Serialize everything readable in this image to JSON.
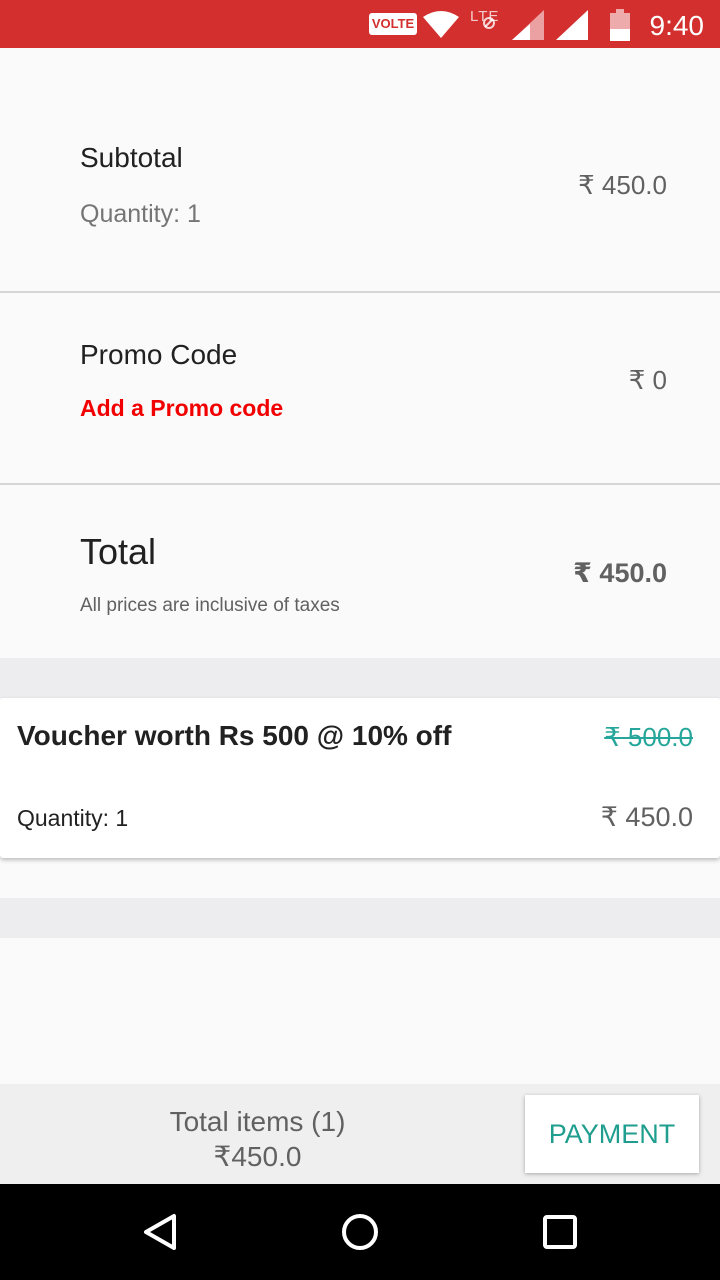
{
  "status_bar": {
    "volte": "VOLTE",
    "lte": "LTE",
    "time": "9:40",
    "icons": [
      "wifi-icon",
      "signal-icon",
      "signal-icon",
      "battery-icon"
    ]
  },
  "subtotal": {
    "title": "Subtotal",
    "quantity": "Quantity: 1",
    "amount": "₹ 450.0"
  },
  "promo": {
    "title": "Promo Code",
    "link": "Add a Promo code",
    "amount": "₹ 0"
  },
  "total": {
    "title": "Total",
    "note": "All prices are inclusive of taxes",
    "amount": "₹ 450.0"
  },
  "item": {
    "name": "Voucher worth Rs 500 @ 10% off",
    "original_price": "₹ 500.0",
    "quantity": "Quantity: 1",
    "price": "₹ 450.0"
  },
  "footer": {
    "items_label": "Total items (1)",
    "items_total": "₹450.0",
    "payment_label": "PAYMENT"
  },
  "nav": {
    "icons": [
      "back-icon",
      "home-icon",
      "recents-icon"
    ]
  },
  "colors": {
    "status_bar": "#d32f2f",
    "promo_link": "#f20000",
    "accent": "#1f9e8f"
  }
}
